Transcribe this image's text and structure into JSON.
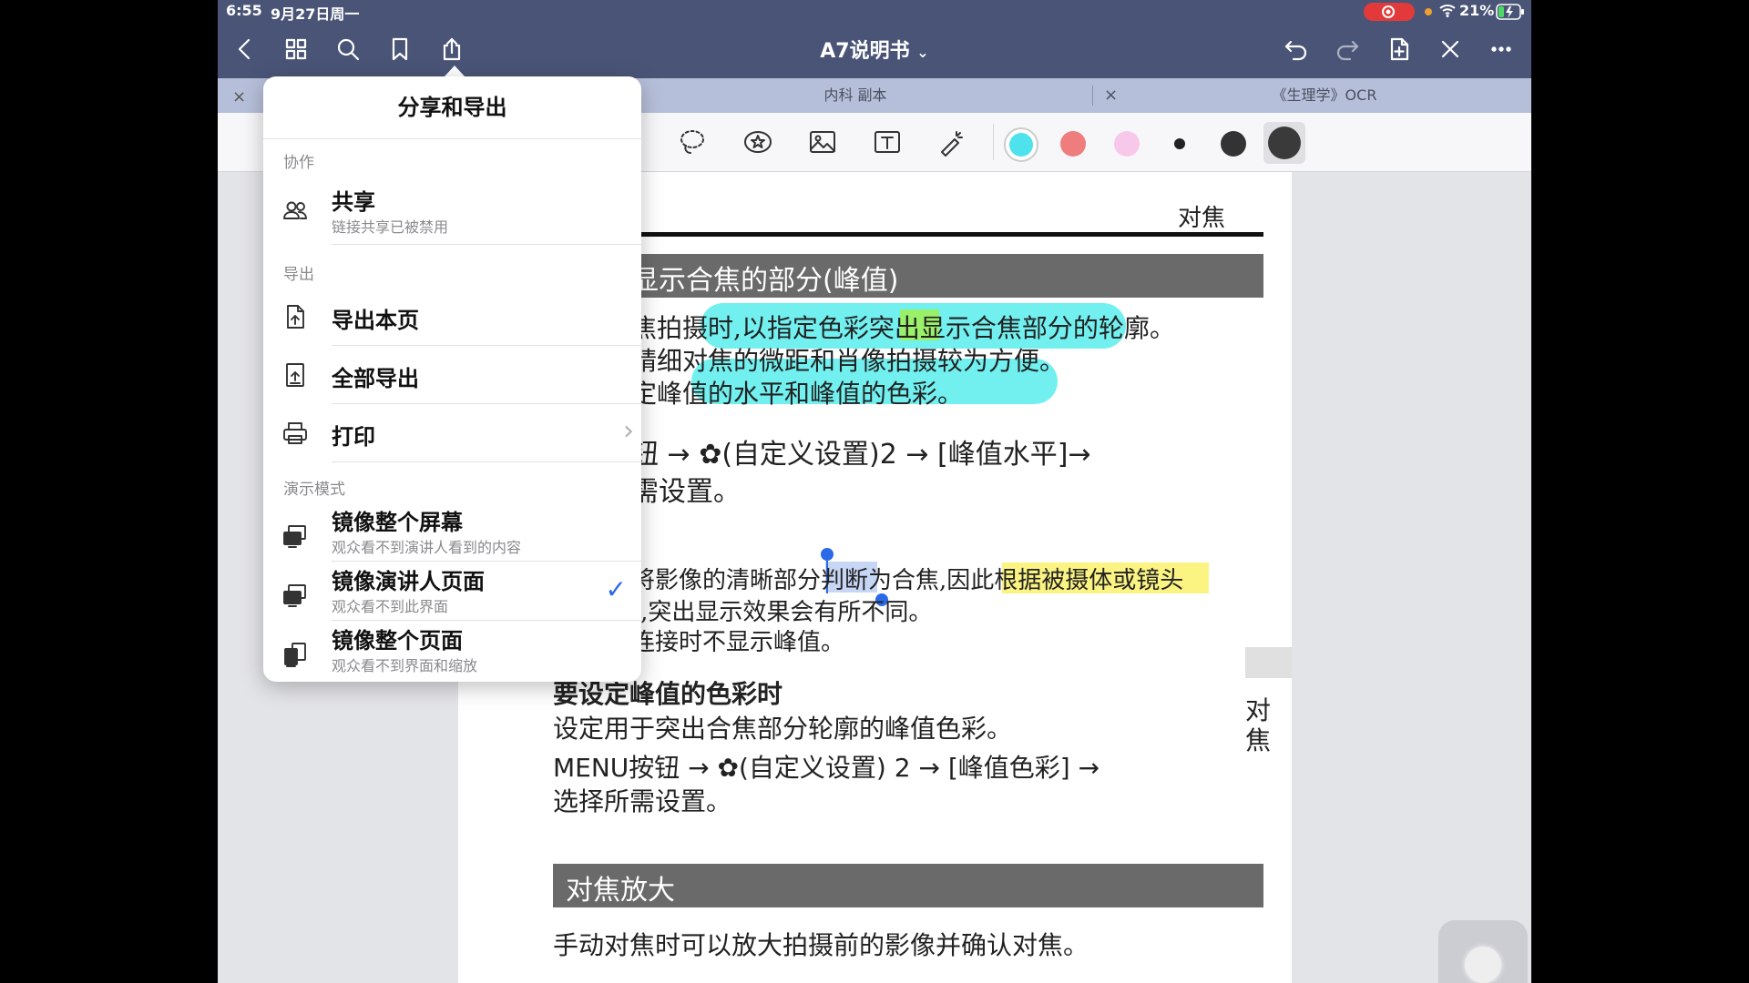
{
  "status": {
    "time": "6:55",
    "date": "9月27日周一",
    "battery": "21%"
  },
  "nav": {
    "title": "A7说明书",
    "title_chevron": "⌄"
  },
  "tabs": [
    {
      "label": "内科 副本",
      "close": "×"
    },
    {
      "label": "《生理学》OCR",
      "close": "×"
    }
  ],
  "left_close": "×",
  "toolbar": {
    "colors": [
      "#4ee3ec",
      "#f07d7d",
      "#f7c8ea",
      "#222222",
      "#333333",
      "#3a3a3a"
    ]
  },
  "popup": {
    "title": "分享和导出",
    "sections": [
      {
        "header": "协作"
      },
      {
        "header": "导出"
      },
      {
        "header": "演示模式"
      }
    ],
    "share": {
      "title": "共享",
      "subtitle": "链接共享已被禁用"
    },
    "export_page": {
      "title": "导出本页"
    },
    "export_all": {
      "title": "全部导出"
    },
    "print": {
      "title": "打印",
      "chevron": "›"
    },
    "mirror_screen": {
      "title": "镜像整个屏幕",
      "subtitle": "观众看不到演讲人看到的内容"
    },
    "mirror_presenter": {
      "title": "镜像演讲人页面",
      "subtitle": "观众看不到此界面",
      "checked": "✓"
    },
    "mirror_page": {
      "title": "镜像整个页面",
      "subtitle": "观众看不到界面和缩放"
    }
  },
  "page": {
    "header_right": "对焦",
    "section1_title": "显示合焦的部分(峰值)",
    "p1_l1": "焦拍摄时,以指定色彩突出显示合焦部分的轮廓。",
    "p1_l2": "精细对焦的微距和肖像拍摄较为方便。",
    "p1_l3": "定峰值的水平和峰值的色彩。",
    "step1_l1": "钮 → ✿(自定义设置)2 → [峰值水平]→",
    "step1_l2": "需设置。",
    "note_l1": "将影像的清晰部分判断为合焦,因此根据被摄体或镜头",
    "note_l2": "],突出显示效果会有所不同。",
    "note_l3": "连接时不显示峰值。",
    "sub_title": "要设定峰值的色彩时",
    "sub_desc": "设定用于突出合焦部分轮廓的峰值色彩。",
    "step2_l1": "MENU按钮 → ✿(自定义设置) 2 → [峰值色彩] →",
    "step2_l2": "选择所需设置。",
    "side_tab_1": "对",
    "side_tab_2": "焦",
    "section2_title": "对焦放大",
    "section2_desc": "手动对焦时可以放大拍摄前的影像并确认对焦。"
  }
}
